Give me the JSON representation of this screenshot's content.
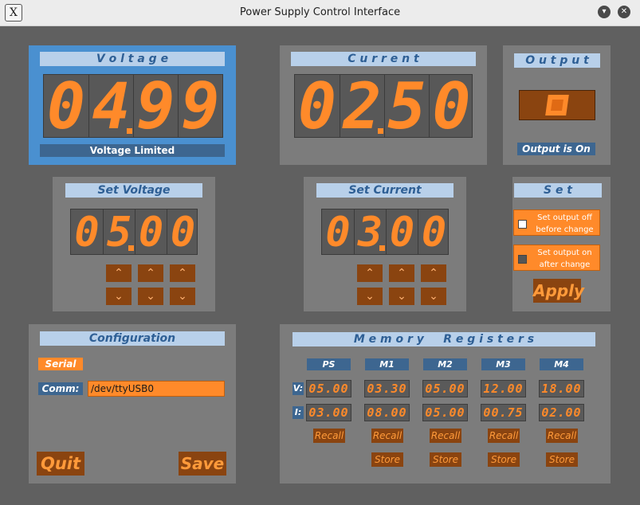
{
  "window": {
    "title": "Power Supply Control Interface"
  },
  "voltage": {
    "title": "V o l t a g e",
    "digits": [
      "0",
      "4",
      "9",
      "9"
    ],
    "status": "Voltage  Limited"
  },
  "current": {
    "title": "C u r r e n t",
    "digits": [
      "0",
      "2",
      "5",
      "0"
    ]
  },
  "output": {
    "title": "O u t p u t",
    "status": "Output is On"
  },
  "set_voltage": {
    "title": "Set  Voltage",
    "digits": [
      "0",
      "5",
      "0",
      "0"
    ]
  },
  "set_current": {
    "title": "Set  Current",
    "digits": [
      "0",
      "3",
      "0",
      "0"
    ]
  },
  "set": {
    "title": "S e t",
    "off_label_1": "Set output off",
    "off_label_2": "before change",
    "on_label_1": "Set output on",
    "on_label_2": "after change",
    "apply_label": "Apply"
  },
  "arrows": {
    "up": "⌃",
    "down": "⌄"
  },
  "configuration": {
    "title": "Configuration",
    "serial_label": "Serial",
    "comm_label": "Comm:",
    "comm_value": "/dev/ttyUSB0",
    "quit_label": "Quit",
    "save_label": "Save"
  },
  "memory": {
    "title": "M e m o r y     R e g i s t e r s",
    "v_label": "V:",
    "i_label": "I:",
    "recall_label": "Recall",
    "store_label": "Store",
    "columns": [
      {
        "name": "PS",
        "v": "05.00",
        "i": "03.00"
      },
      {
        "name": "M1",
        "v": "03.30",
        "i": "08.00"
      },
      {
        "name": "M2",
        "v": "05.00",
        "i": "05.00"
      },
      {
        "name": "M3",
        "v": "12.00",
        "i": "00.75"
      },
      {
        "name": "M4",
        "v": "18.00",
        "i": "02.00"
      }
    ]
  },
  "colors": {
    "segment": "#ff8a2a",
    "panel": "#7c7c7c",
    "highlight": "#4a90d0",
    "title_bg": "#b8d0ea",
    "button_bg": "#8a4410"
  }
}
